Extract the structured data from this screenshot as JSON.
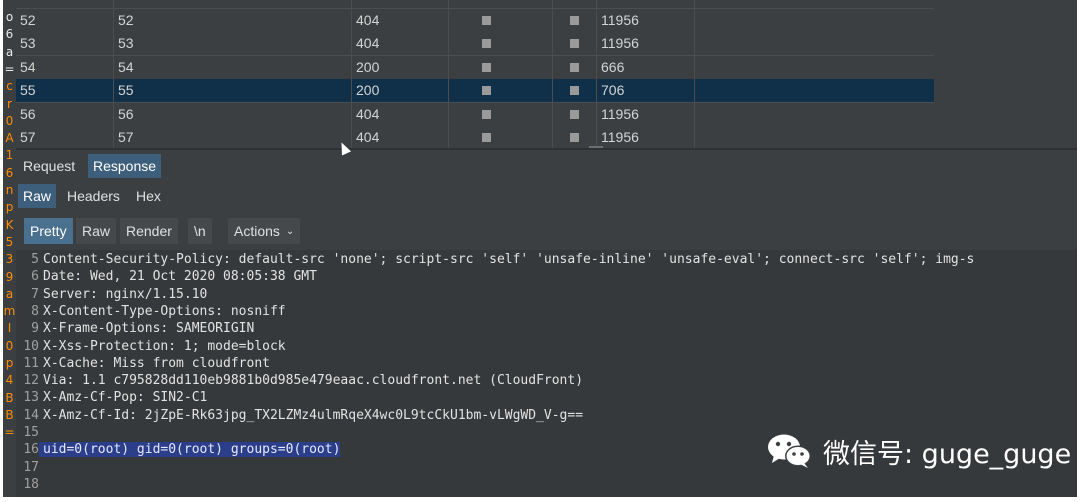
{
  "gutter_letters": [
    {
      "ch": "o",
      "color": "#e8e8e8"
    },
    {
      "ch": "6",
      "color": "#e8e8e8"
    },
    {
      "ch": "a",
      "color": "#e8e8e8"
    },
    {
      "ch": "=",
      "color": "#e8e8e8"
    },
    {
      "ch": "c",
      "color": "#ff8c00"
    },
    {
      "ch": "r",
      "color": "#ff8c00"
    },
    {
      "ch": "0",
      "color": "#ff8c00"
    },
    {
      "ch": "A",
      "color": "#ff8c00"
    },
    {
      "ch": "1",
      "color": "#ff8c00"
    },
    {
      "ch": "6",
      "color": "#ff8c00"
    },
    {
      "ch": "n",
      "color": "#ff8c00"
    },
    {
      "ch": "p",
      "color": "#ff8c00"
    },
    {
      "ch": "K",
      "color": "#ff8c00"
    },
    {
      "ch": "5",
      "color": "#ff8c00"
    },
    {
      "ch": "3",
      "color": "#ff8c00"
    },
    {
      "ch": "9",
      "color": "#ff8c00"
    },
    {
      "ch": "a",
      "color": "#ff8c00"
    },
    {
      "ch": "m",
      "color": "#ff8c00"
    },
    {
      "ch": "I",
      "color": "#ff8c00"
    },
    {
      "ch": "0",
      "color": "#ff8c00"
    },
    {
      "ch": "p",
      "color": "#ff8c00"
    },
    {
      "ch": "4",
      "color": "#ff8c00"
    },
    {
      "ch": "B",
      "color": "#ff8c00"
    },
    {
      "ch": "B",
      "color": "#ff8c00"
    },
    {
      "ch": "=",
      "color": "#ff8c00"
    }
  ],
  "table": {
    "rows": [
      {
        "c0": "52",
        "c1": "52",
        "c2": "404",
        "c5": "11956",
        "selected": false
      },
      {
        "c0": "53",
        "c1": "53",
        "c2": "404",
        "c5": "11956",
        "selected": false
      },
      {
        "c0": "54",
        "c1": "54",
        "c2": "200",
        "c5": "666",
        "selected": false
      },
      {
        "c0": "55",
        "c1": "55",
        "c2": "200",
        "c5": "706",
        "selected": true
      },
      {
        "c0": "56",
        "c1": "56",
        "c2": "404",
        "c5": "11956",
        "selected": false
      },
      {
        "c0": "57",
        "c1": "57",
        "c2": "404",
        "c5": "11956",
        "selected": false
      }
    ]
  },
  "tabs_top": {
    "request": "Request",
    "response": "Response"
  },
  "tabs_view": {
    "raw": "Raw",
    "headers": "Headers",
    "hex": "Hex"
  },
  "toolbar": {
    "pretty": "Pretty",
    "raw": "Raw",
    "render": "Render",
    "newline": "\\n",
    "actions": "Actions"
  },
  "editor": {
    "lines": [
      {
        "n": "5",
        "t": "Content-Security-Policy: default-src 'none'; script-src 'self' 'unsafe-inline' 'unsafe-eval'; connect-src 'self'; img-s",
        "hl": false
      },
      {
        "n": "6",
        "t": "Date: Wed, 21 Oct 2020 08:05:38 GMT",
        "hl": false
      },
      {
        "n": "7",
        "t": "Server: nginx/1.15.10",
        "hl": false
      },
      {
        "n": "8",
        "t": "X-Content-Type-Options: nosniff",
        "hl": false
      },
      {
        "n": "9",
        "t": "X-Frame-Options: SAMEORIGIN",
        "hl": false
      },
      {
        "n": "10",
        "t": "X-Xss-Protection: 1; mode=block",
        "hl": false
      },
      {
        "n": "11",
        "t": "X-Cache: Miss from cloudfront",
        "hl": false
      },
      {
        "n": "12",
        "t": "Via: 1.1 c795828dd110eb9881b0d985e479eaac.cloudfront.net (CloudFront)",
        "hl": false
      },
      {
        "n": "13",
        "t": "X-Amz-Cf-Pop: SIN2-C1",
        "hl": false
      },
      {
        "n": "14",
        "t": "X-Amz-Cf-Id: 2jZpE-Rk63jpg_TX2LZMz4ulmRqeX4wc0L9tcCkU1bm-vLWgWD_V-g==",
        "hl": false
      },
      {
        "n": "15",
        "t": "",
        "hl": false
      },
      {
        "n": "16",
        "t": "uid=0(root) gid=0(root) groups=0(root)",
        "hl": true
      },
      {
        "n": "17",
        "t": "",
        "hl": false
      },
      {
        "n": "18",
        "t": "",
        "hl": false
      }
    ]
  },
  "watermark": {
    "text": "微信号: guge_guge",
    "icon": "wechat-icon"
  }
}
